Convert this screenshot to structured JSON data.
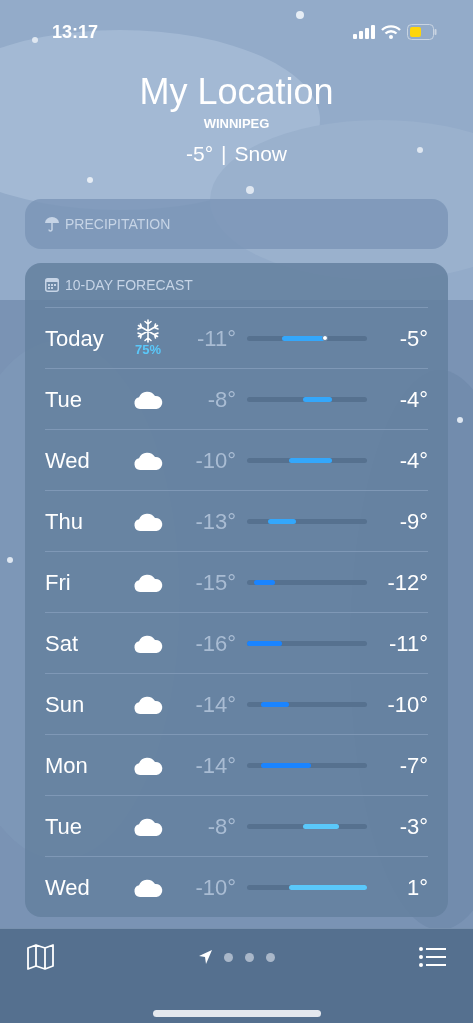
{
  "status_bar": {
    "time": "13:17"
  },
  "header": {
    "title": "My Location",
    "city": "WINNIPEG",
    "temperature": "-5°",
    "separator": "|",
    "condition": "Snow"
  },
  "precipitation_card": {
    "title": "PRECIPITATION"
  },
  "forecast": {
    "title": "10-DAY FORECAST",
    "days": [
      {
        "day": "Today",
        "kind": "snow",
        "chance": "75%",
        "low": "-11°",
        "high": "-5°",
        "current": true
      },
      {
        "day": "Tue",
        "kind": "cloud",
        "low": "-8°",
        "high": "-4°",
        "current": false
      },
      {
        "day": "Wed",
        "kind": "cloud",
        "low": "-10°",
        "high": "-4°",
        "current": false
      },
      {
        "day": "Thu",
        "kind": "cloud",
        "low": "-13°",
        "high": "-9°",
        "current": false
      },
      {
        "day": "Fri",
        "kind": "cloud",
        "low": "-15°",
        "high": "-12°",
        "current": false
      },
      {
        "day": "Sat",
        "kind": "cloud",
        "low": "-16°",
        "high": "-11°",
        "current": false
      },
      {
        "day": "Sun",
        "kind": "cloud",
        "low": "-14°",
        "high": "-10°",
        "current": false
      },
      {
        "day": "Mon",
        "kind": "cloud",
        "low": "-14°",
        "high": "-7°",
        "current": false
      },
      {
        "day": "Tue",
        "kind": "cloud",
        "low": "-8°",
        "high": "-3°",
        "current": false
      },
      {
        "day": "Wed",
        "kind": "cloud",
        "low": "-10°",
        "high": "1°",
        "current": false
      }
    ]
  },
  "pages": [
    {
      "kind": "location",
      "selected": true
    },
    {
      "kind": "dot",
      "selected": false
    },
    {
      "kind": "dot",
      "selected": false
    },
    {
      "kind": "dot",
      "selected": false
    }
  ]
}
